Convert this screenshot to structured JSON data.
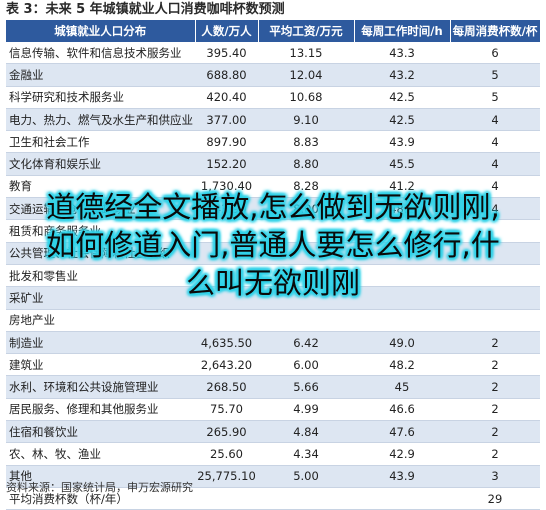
{
  "title": "表 3：未来 5 年城镇就业人口消费咖啡杯数预测",
  "headers": [
    "城镇就业人口分布",
    "人数/万人",
    "平均工资/万元",
    "每周工作时间/h",
    "每周消费杯数/杯"
  ],
  "rows": [
    [
      "信息传输、软件和信息技术服务业",
      "395.40",
      "13.15",
      "43.3",
      "6"
    ],
    [
      "金融业",
      "688.80",
      "12.04",
      "43.2",
      "5"
    ],
    [
      "科学研究和技术服务业",
      "420.40",
      "10.68",
      "42.5",
      "5"
    ],
    [
      "电力、热力、燃气及水生产和供应业",
      "377.00",
      "9.10",
      "42.5",
      "4"
    ],
    [
      "卫生和社会工作",
      "897.90",
      "8.83",
      "43.9",
      "4"
    ],
    [
      "文化体育和娱乐业",
      "152.20",
      "8.80",
      "45.5",
      "4"
    ],
    [
      "教育",
      "1,730.40",
      "8.28",
      "41.2",
      "4"
    ],
    [
      "交通运输、仓储和邮政业",
      "843.90",
      "8.00",
      "48.1",
      "4"
    ],
    [
      "租赁和商务服务业",
      "",
      "",
      "",
      ""
    ],
    [
      "公共管理、社会保障和社会组织",
      "",
      "",
      "",
      ""
    ],
    [
      "批发和零售业",
      "",
      "",
      "",
      ""
    ],
    [
      "采矿业",
      "",
      "",
      "",
      ""
    ],
    [
      "房地产业",
      "",
      "",
      "",
      ""
    ],
    [
      "制造业",
      "4,635.50",
      "6.42",
      "49.0",
      "2"
    ],
    [
      "建筑业",
      "2,643.20",
      "6.00",
      "48.2",
      "2"
    ],
    [
      "水利、环境和公共设施管理业",
      "268.50",
      "5.66",
      "45",
      "2"
    ],
    [
      "居民服务、修理和其他服务业",
      "75.70",
      "4.99",
      "46.6",
      "2"
    ],
    [
      "住宿和餐饮业",
      "265.90",
      "4.84",
      "47.6",
      "2"
    ],
    [
      "农、林、牧、渔业",
      "25.60",
      "4.34",
      "42.9",
      "2"
    ],
    [
      "其他",
      "25,775.10",
      "5.00",
      "43.9",
      "3"
    ]
  ],
  "footer_row": [
    "平均消费杯数（杯/年）",
    "",
    "",
    "",
    "29"
  ],
  "source": "资料来源：国家统计局，申万宏源研究",
  "overlay_text": "道德经全文播放,怎么做到无欲则刚,如何修道入门,普通人要怎么修行,什么叫无欲则刚",
  "colors": {
    "header_bg": "#2e5a9e",
    "alt_row_bg": "#dde6f2",
    "overlay_glow": "#2fd2e8"
  }
}
